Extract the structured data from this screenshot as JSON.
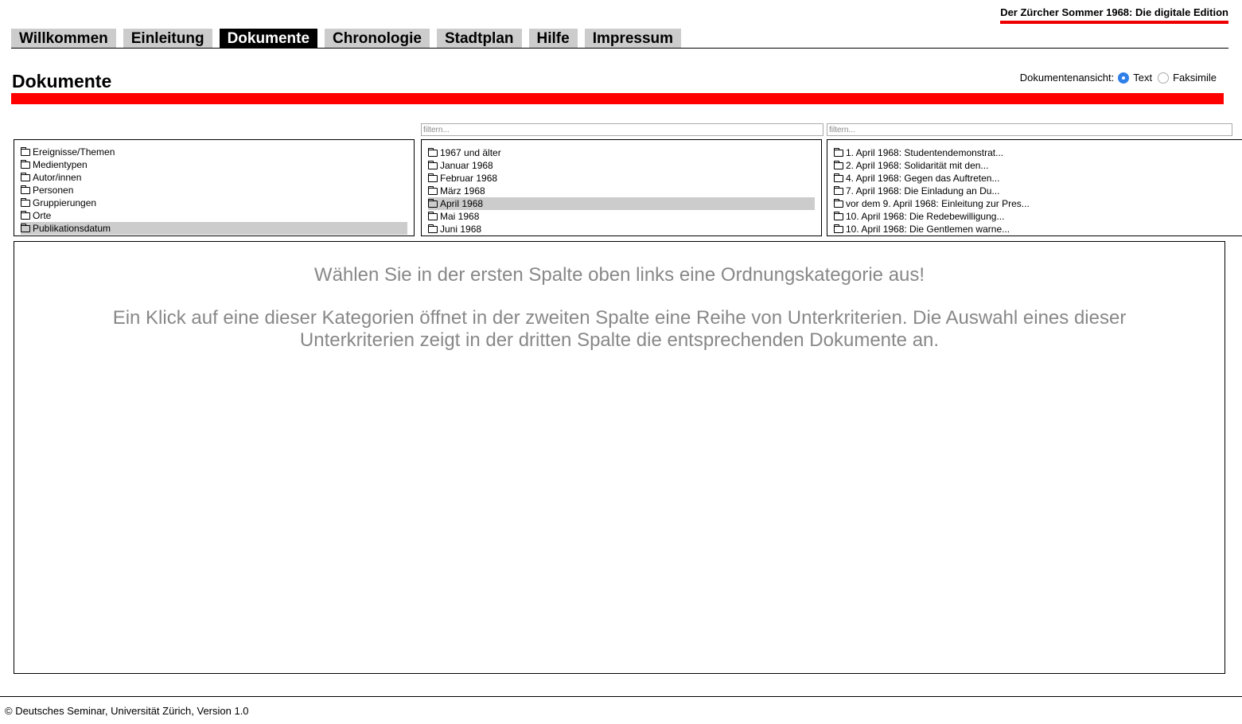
{
  "site_title": "Der Zürcher Sommer 1968: Die digitale Edition",
  "nav": {
    "tabs": [
      {
        "label": "Willkommen",
        "active": false
      },
      {
        "label": "Einleitung",
        "active": false
      },
      {
        "label": "Dokumente",
        "active": true
      },
      {
        "label": "Chronologie",
        "active": false
      },
      {
        "label": "Stadtplan",
        "active": false
      },
      {
        "label": "Hilfe",
        "active": false
      },
      {
        "label": "Impressum",
        "active": false
      }
    ]
  },
  "page_title": "Dokumente",
  "view_switch": {
    "label": "Dokumentenansicht:",
    "options": [
      {
        "label": "Text",
        "checked": true
      },
      {
        "label": "Faksimile",
        "checked": false
      }
    ]
  },
  "filters": {
    "column2_placeholder": "filtern...",
    "column3_placeholder": "filtern..."
  },
  "columns": {
    "categories": [
      {
        "label": "Ereignisse/Themen",
        "selected": false
      },
      {
        "label": "Medientypen",
        "selected": false
      },
      {
        "label": "Autor/innen",
        "selected": false
      },
      {
        "label": "Personen",
        "selected": false
      },
      {
        "label": "Gruppierungen",
        "selected": false
      },
      {
        "label": "Orte",
        "selected": false
      },
      {
        "label": "Publikationsdatum",
        "selected": true
      }
    ],
    "subcriteria": [
      {
        "label": "1967 und älter",
        "selected": false
      },
      {
        "label": "Januar 1968",
        "selected": false
      },
      {
        "label": "Februar 1968",
        "selected": false
      },
      {
        "label": "März 1968",
        "selected": false
      },
      {
        "label": "April 1968",
        "selected": true
      },
      {
        "label": "Mai 1968",
        "selected": false
      },
      {
        "label": "Juni 1968",
        "selected": false
      }
    ],
    "documents": [
      {
        "label": "1. April 1968: Studentendemonstrat...",
        "selected": false
      },
      {
        "label": "2. April 1968: Solidarität mit den...",
        "selected": false
      },
      {
        "label": "4. April 1968: Gegen das Auftreten...",
        "selected": false
      },
      {
        "label": "7. April 1968: Die Einladung an Du...",
        "selected": false
      },
      {
        "label": "vor dem 9. April 1968: Einleitung zur Pres...",
        "selected": false
      },
      {
        "label": "10. April 1968: Die Redebewilligung...",
        "selected": false
      },
      {
        "label": "10. April 1968: Die Gentlemen warne...",
        "selected": false
      }
    ]
  },
  "main": {
    "instruction_1": "Wählen Sie in der ersten Spalte oben links eine Ordnungskategorie aus!",
    "instruction_2": "Ein Klick auf eine dieser Kategorien öffnet in der zweiten Spalte eine Reihe von Unterkriterien. Die Auswahl eines dieser Unterkriterien zeigt in der dritten Spalte die entsprechenden Dokumente an."
  },
  "footer": "© Deutsches Seminar, Universität Zürich, Version 1.0"
}
